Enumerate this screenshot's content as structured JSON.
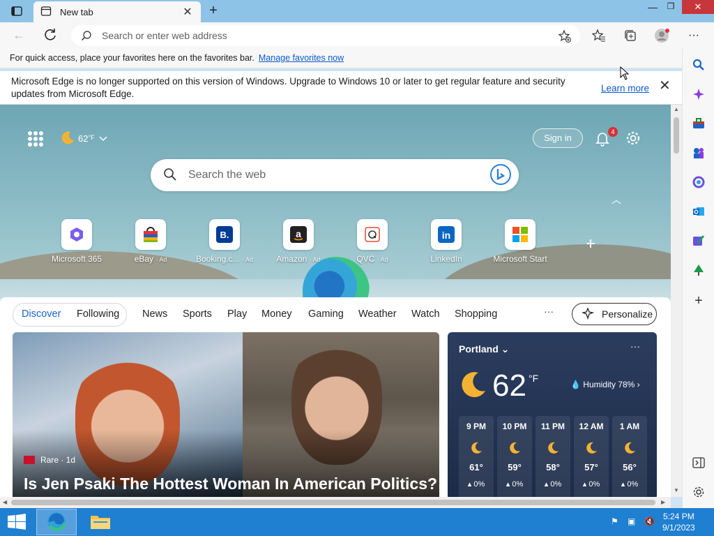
{
  "tab": {
    "title": "New tab",
    "close": "✕",
    "new_tab": "+"
  },
  "window": {
    "minimize": "—",
    "maximize": "❐",
    "close": "✕"
  },
  "toolbar": {
    "address_placeholder": "Search or enter web address"
  },
  "favbar": {
    "text": "For quick access, place your favorites here on the favorites bar.",
    "link": "Manage favorites now"
  },
  "infobar": {
    "text": "Microsoft Edge is no longer supported on this version of Windows. Upgrade to Windows 10 or later to get regular feature and security updates from Microsoft Edge.",
    "learn_more": "Learn more"
  },
  "ntp": {
    "weather_temp": "62",
    "weather_unit": "°F",
    "sign_in": "Sign in",
    "notifications": "4",
    "search_placeholder": "Search the web",
    "quick_links": [
      {
        "label": "Microsoft 365",
        "ad": ""
      },
      {
        "label": "eBay",
        "ad": "· Ad"
      },
      {
        "label": "Booking.c...",
        "ad": "· Ad"
      },
      {
        "label": "Amazon",
        "ad": "· Ad"
      },
      {
        "label": "QVC",
        "ad": "· Ad"
      },
      {
        "label": "LinkedIn",
        "ad": ""
      },
      {
        "label": "Microsoft Start",
        "ad": ""
      }
    ]
  },
  "feed": {
    "tabs": [
      "Discover",
      "Following",
      "News",
      "Sports",
      "Play",
      "Money",
      "Gaming",
      "Weather",
      "Watch",
      "Shopping"
    ],
    "more": "···",
    "personalize": "Personalize",
    "hero": {
      "source": "Rare · 1d",
      "title": "Is Jen Psaki The Hottest Woman In American Politics?"
    }
  },
  "weather": {
    "city": "Portland",
    "more": "···",
    "temp": "62",
    "unit": "°F",
    "humidity": "Humidity 78%",
    "hours": [
      {
        "time": "9 PM",
        "temp": "61°",
        "precip": "0%"
      },
      {
        "time": "10 PM",
        "temp": "59°",
        "precip": "0%"
      },
      {
        "time": "11 PM",
        "temp": "58°",
        "precip": "0%"
      },
      {
        "time": "12 AM",
        "temp": "57°",
        "precip": "0%"
      },
      {
        "time": "1 AM",
        "temp": "56°",
        "precip": "0%"
      }
    ]
  },
  "taskbar": {
    "time": "5:24 PM",
    "date": "9/1/2023"
  },
  "colors": {
    "accent": "#1a64c8",
    "taskbar": "#1f7fd1",
    "close": "#c7363b"
  }
}
